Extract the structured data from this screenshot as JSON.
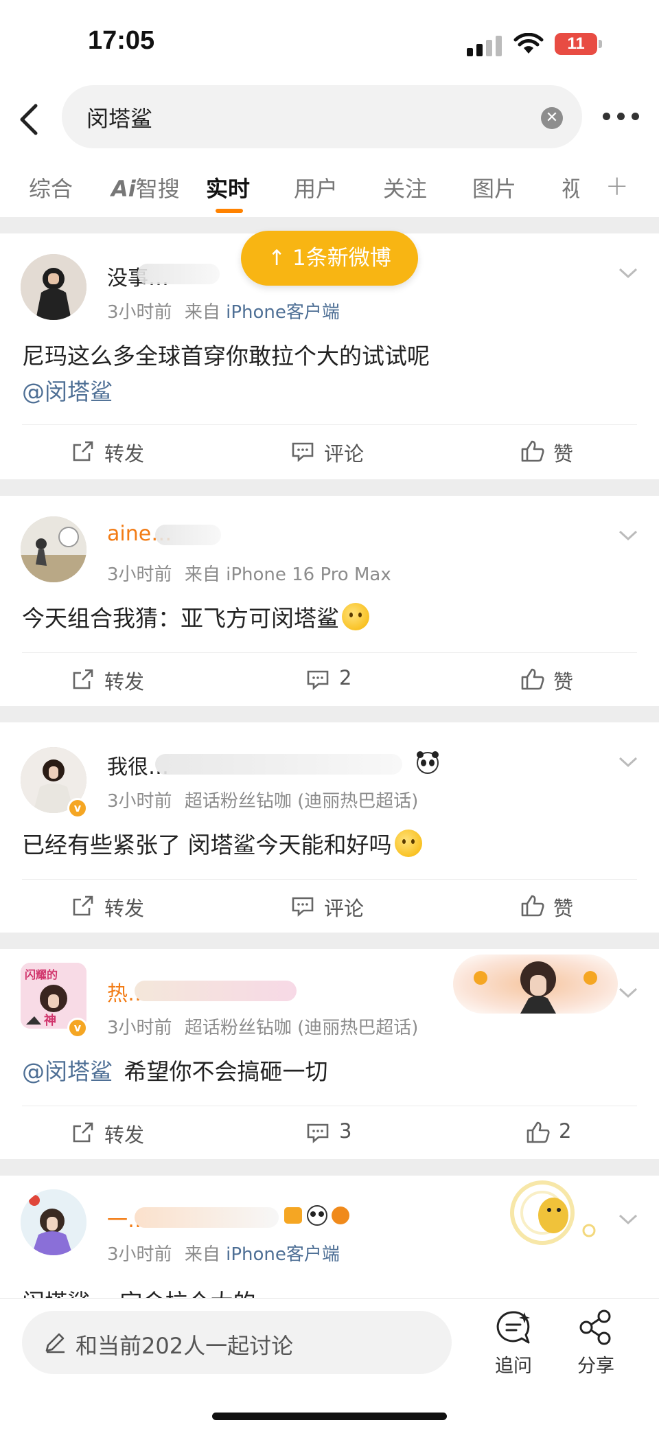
{
  "status_bar": {
    "time": "17:05",
    "battery": "11"
  },
  "search": {
    "query": "闵塔鲨"
  },
  "tabs": [
    {
      "label": "综合"
    },
    {
      "label": "智搜",
      "prefix": "Ai"
    },
    {
      "label": "实时"
    },
    {
      "label": "用户"
    },
    {
      "label": "关注"
    },
    {
      "label": "图片"
    },
    {
      "label": "视"
    }
  ],
  "new_posts_pill": "↑ 1条新微博",
  "posts": [
    {
      "username": "没事…",
      "time": "3小时前",
      "source_prefix": "来自",
      "source": "iPhone客户端",
      "content_text": "尼玛这么多全球首穿你敢拉个大的试试呢",
      "mention": "@闵塔鲨",
      "repost_label": "转发",
      "comment_label": "评论",
      "like_label": "赞"
    },
    {
      "username": "aine…",
      "time": "3小时前",
      "source_prefix": "来自",
      "source": "iPhone 16 Pro Max",
      "content_text": "今天组合我猜：亚飞方可闵塔鲨",
      "repost_label": "转发",
      "comment_label": "2",
      "like_label": "赞"
    },
    {
      "username": "我很…",
      "time": "3小时前",
      "source_prefix": "超话粉丝钻咖",
      "source": "(迪丽热巴超话)",
      "content_text": "已经有些紧张了 闵塔鲨今天能和好吗",
      "repost_label": "转发",
      "comment_label": "评论",
      "like_label": "赞"
    },
    {
      "username": "热…",
      "time": "3小时前",
      "source_prefix": "超话粉丝钻咖",
      "source": "(迪丽热巴超话)",
      "mention": "@闵塔鲨",
      "content_text": "希望你不会搞砸一切",
      "repost_label": "转发",
      "comment_label": "3",
      "like_label": "2",
      "avatar_text_top": "闪耀的",
      "avatar_text_bottom": "神"
    },
    {
      "username": "一…",
      "time": "3小时前",
      "source_prefix": "来自",
      "source": "iPhone客户端",
      "content_text": "闵塔鲨 一定会拉个大的"
    }
  ],
  "bottom_bar": {
    "composer_placeholder": "和当前202人一起讨论",
    "ask_label": "追问",
    "share_label": "分享"
  },
  "colors": {
    "accent": "#ff8200",
    "link": "#4e6f95",
    "pill": "#f8b513"
  },
  "icons": [
    "back-icon",
    "clear-icon",
    "more-icon",
    "chevron-down-icon",
    "repost-icon",
    "comment-icon",
    "like-icon",
    "pencil-icon",
    "ask-icon",
    "share-icon"
  ]
}
